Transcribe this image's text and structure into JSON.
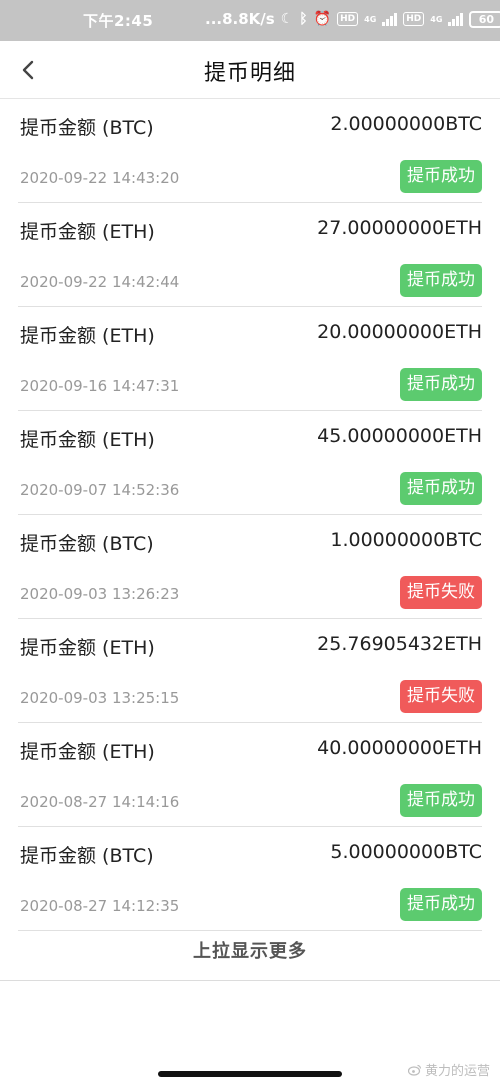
{
  "status_bar": {
    "time": "下午2:45",
    "speed": "...8.8K/s",
    "network_chip_1": "HD",
    "network_label_1": "4G",
    "network_chip_2": "HD",
    "network_label_2": "4G",
    "battery": "60"
  },
  "header": {
    "title": "提币明细",
    "back_icon": "chevron-left-icon"
  },
  "records": [
    {
      "label": "提币金额 (BTC)",
      "amount": "2.00000000BTC",
      "time": "2020-09-22 14:43:20",
      "status": "提币成功",
      "status_type": "success"
    },
    {
      "label": "提币金额 (ETH)",
      "amount": "27.00000000ETH",
      "time": "2020-09-22 14:42:44",
      "status": "提币成功",
      "status_type": "success"
    },
    {
      "label": "提币金额 (ETH)",
      "amount": "20.00000000ETH",
      "time": "2020-09-16 14:47:31",
      "status": "提币成功",
      "status_type": "success"
    },
    {
      "label": "提币金额 (ETH)",
      "amount": "45.00000000ETH",
      "time": "2020-09-07 14:52:36",
      "status": "提币成功",
      "status_type": "success"
    },
    {
      "label": "提币金额 (BTC)",
      "amount": "1.00000000BTC",
      "time": "2020-09-03 13:26:23",
      "status": "提币失败",
      "status_type": "failure"
    },
    {
      "label": "提币金额 (ETH)",
      "amount": "25.76905432ETH",
      "time": "2020-09-03 13:25:15",
      "status": "提币失败",
      "status_type": "failure"
    },
    {
      "label": "提币金额 (ETH)",
      "amount": "40.00000000ETH",
      "time": "2020-08-27 14:14:16",
      "status": "提币成功",
      "status_type": "success"
    },
    {
      "label": "提币金额 (BTC)",
      "amount": "5.00000000BTC",
      "time": "2020-08-27 14:12:35",
      "status": "提币成功",
      "status_type": "success"
    }
  ],
  "load_more": "上拉显示更多",
  "watermark": "黄力的运营",
  "colors": {
    "success": "#5ccb6f",
    "failure": "#f05a5a",
    "status_bar": "#c4c4c4"
  }
}
